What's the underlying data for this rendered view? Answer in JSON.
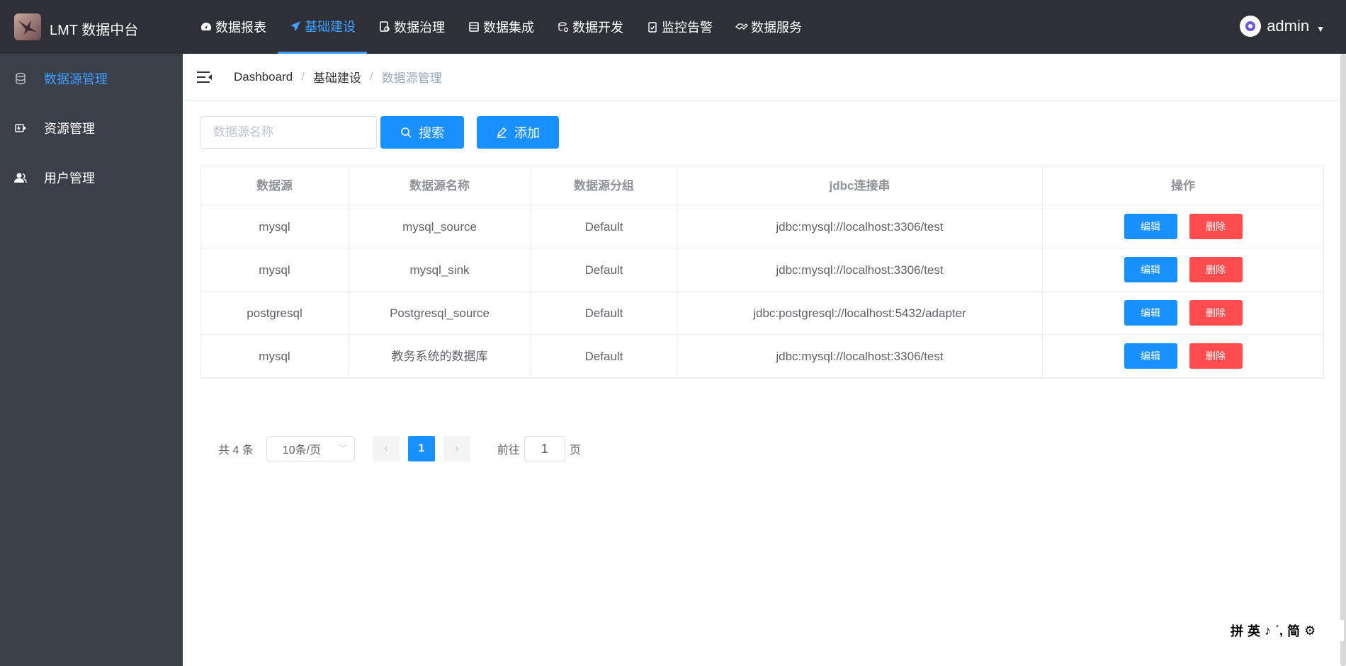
{
  "app": {
    "title": "LMT 数据中台"
  },
  "nav": {
    "items": [
      {
        "label": "数据报表",
        "icon": "dashboard-icon"
      },
      {
        "label": "基础建设",
        "icon": "paper-plane-icon",
        "active": true
      },
      {
        "label": "数据治理",
        "icon": "governance-icon"
      },
      {
        "label": "数据集成",
        "icon": "server-icon"
      },
      {
        "label": "数据开发",
        "icon": "database-gear-icon"
      },
      {
        "label": "监控告警",
        "icon": "clipboard-icon"
      },
      {
        "label": "数据服务",
        "icon": "handshake-icon"
      }
    ]
  },
  "user": {
    "name": "admin"
  },
  "sidebar": {
    "items": [
      {
        "label": "数据源管理",
        "icon": "database-icon",
        "active": true
      },
      {
        "label": "资源管理",
        "icon": "resource-icon"
      },
      {
        "label": "用户管理",
        "icon": "user-icon"
      }
    ]
  },
  "breadcrumb": {
    "items": [
      "Dashboard",
      "基础建设",
      "数据源管理"
    ],
    "separator": "/"
  },
  "toolbar": {
    "search_placeholder": "数据源名称",
    "search_label": "搜索",
    "add_label": "添加"
  },
  "table": {
    "headers": [
      "数据源",
      "数据源名称",
      "数据源分组",
      "jdbc连接串",
      "操作"
    ],
    "rows": [
      {
        "source": "mysql",
        "name": "mysql_source",
        "group": "Default",
        "jdbc": "jdbc:mysql://localhost:3306/test"
      },
      {
        "source": "mysql",
        "name": "mysql_sink",
        "group": "Default",
        "jdbc": "jdbc:mysql://localhost:3306/test"
      },
      {
        "source": "postgresql",
        "name": "Postgresql_source",
        "group": "Default",
        "jdbc": "jdbc:postgresql://localhost:5432/adapter"
      },
      {
        "source": "mysql",
        "name": "教务系统的数据库",
        "group": "Default",
        "jdbc": "jdbc:mysql://localhost:3306/test"
      }
    ],
    "edit_label": "编辑",
    "delete_label": "删除"
  },
  "pagination": {
    "total": "共 4 条",
    "page_size": "10条/页",
    "current_page": "1",
    "goto_prefix": "前往",
    "goto_value": "1",
    "goto_suffix": "页"
  },
  "ime": {
    "items": [
      "拼",
      "英",
      "♪",
      "˙,",
      "简",
      "⚙"
    ]
  },
  "colors": {
    "primary": "#1890ff",
    "danger": "#ff4d4f",
    "topbar": "#2d3037",
    "sidebar": "#3b3f4a",
    "active": "#409eff"
  }
}
